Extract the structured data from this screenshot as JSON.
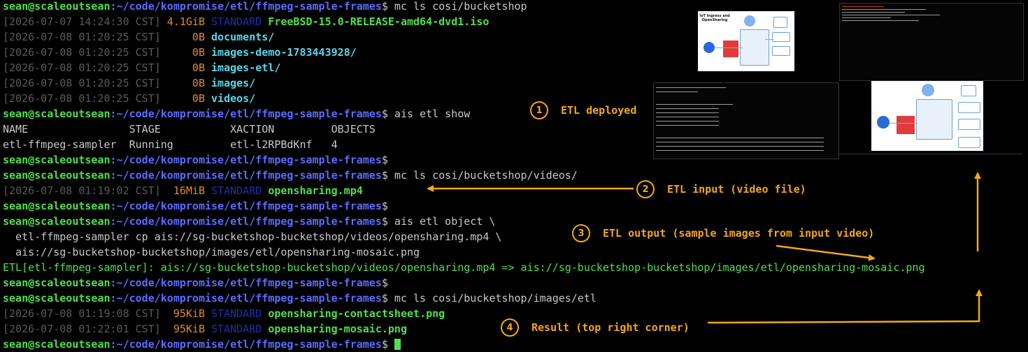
{
  "terminal": {
    "prompt": {
      "user": "sean@scaleoutsean",
      "path": ":~/code/kompromise/etl/ffmpeg-sample-frames",
      "symbol": "$"
    },
    "lines": [
      {
        "type": "prompt",
        "cmd": " mc ls cosi/bucketshop"
      },
      {
        "type": "ls",
        "date": "[2026-07-07 14:24:30 CST]",
        "size": " 4.1GiB",
        "cls": "STANDARD",
        "name": "FreeBSD-15.0-RELEASE-amd64-dvd1.iso",
        "kind": "file"
      },
      {
        "type": "ls",
        "date": "[2026-07-08 01:20:25 CST]",
        "size": "     0B",
        "cls": "",
        "name": "documents/",
        "kind": "dir"
      },
      {
        "type": "ls",
        "date": "[2026-07-08 01:20:25 CST]",
        "size": "     0B",
        "cls": "",
        "name": "images-demo-1783443928/",
        "kind": "dir"
      },
      {
        "type": "ls",
        "date": "[2026-07-08 01:20:25 CST]",
        "size": "     0B",
        "cls": "",
        "name": "images-etl/",
        "kind": "dir"
      },
      {
        "type": "ls",
        "date": "[2026-07-08 01:20:25 CST]",
        "size": "     0B",
        "cls": "",
        "name": "images/",
        "kind": "dir"
      },
      {
        "type": "ls",
        "date": "[2026-07-08 01:20:25 CST]",
        "size": "     0B",
        "cls": "",
        "name": "videos/",
        "kind": "dir"
      },
      {
        "type": "prompt",
        "cmd": " ais etl show"
      },
      {
        "type": "text",
        "text": "NAME                STAGE           XACTION         OBJECTS"
      },
      {
        "type": "text",
        "text": "etl-ffmpeg-sampler  Running         etl-l2RPBdKnf   4"
      },
      {
        "type": "prompt",
        "cmd": ""
      },
      {
        "type": "prompt",
        "cmd": " mc ls cosi/bucketshop/videos/"
      },
      {
        "type": "ls",
        "date": "[2026-07-08 01:19:02 CST]",
        "size": "  16MiB",
        "cls": "STANDARD",
        "name": "opensharing.mp4",
        "kind": "file"
      },
      {
        "type": "prompt",
        "cmd": ""
      },
      {
        "type": "prompt",
        "cmd": " ais etl object \\"
      },
      {
        "type": "text",
        "text": "  etl-ffmpeg-sampler cp ais://sg-bucketshop-bucketshop/videos/opensharing.mp4 \\"
      },
      {
        "type": "text",
        "text": "  ais://sg-bucketshop-bucketshop/images/etl/opensharing-mosaic.png"
      },
      {
        "type": "etl",
        "text": "ETL[etl-ffmpeg-sampler]: ais://sg-bucketshop-bucketshop/videos/opensharing.mp4 => ais://sg-bucketshop-bucketshop/images/etl/opensharing-mosaic.png"
      },
      {
        "type": "prompt",
        "cmd": ""
      },
      {
        "type": "prompt",
        "cmd": " mc ls cosi/bucketshop/images/etl"
      },
      {
        "type": "ls",
        "date": "[2026-07-08 01:19:08 CST]",
        "size": "  95KiB",
        "cls": "STANDARD",
        "name": "opensharing-contactsheet.png",
        "kind": "file"
      },
      {
        "type": "ls",
        "date": "[2026-07-08 01:22:01 CST]",
        "size": "  95KiB",
        "cls": "STANDARD",
        "name": "opensharing-mosaic.png",
        "kind": "file"
      },
      {
        "type": "cursor",
        "cmd": ""
      }
    ]
  },
  "annotations": [
    {
      "num": "1",
      "label": "ETL deployed"
    },
    {
      "num": "2",
      "label": "ETL input (video file)"
    },
    {
      "num": "3",
      "label": "ETL output (sample images from input video)"
    },
    {
      "num": "4",
      "label": "Result (top right corner)"
    }
  ],
  "colors": {
    "annotation": "#f2a818",
    "prompt_user": "#4ee04e",
    "prompt_path": "#5c6bff",
    "size": "#e08a2a",
    "dir": "#58d8e8"
  },
  "thumbnails": {
    "diagram_title": "IoT Ingress and OpenSharing"
  }
}
